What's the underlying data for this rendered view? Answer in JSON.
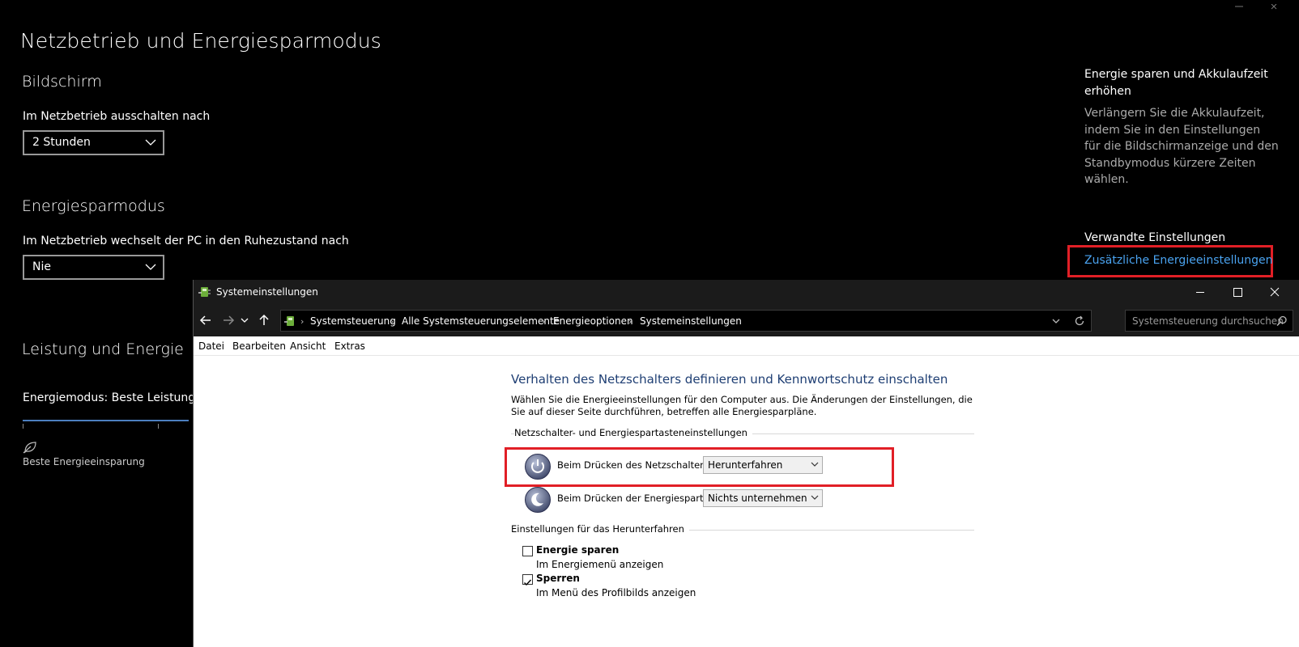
{
  "settings": {
    "page_title": "Netzbetrieb und Energiesparmodus",
    "display": {
      "title": "Bildschirm",
      "label": "Im Netzbetrieb ausschalten nach",
      "value": "2 Stunden"
    },
    "sleep": {
      "title": "Energiesparmodus",
      "label": "Im Netzbetrieb wechselt der PC in den Ruhezustand nach",
      "value": "Nie"
    },
    "performance": {
      "title": "Leistung und Energie",
      "mode_label": "Energiemodus: Beste Leistung",
      "slider_end_label": "Beste Energieeinsparung"
    },
    "side": {
      "tip_title": "Energie sparen und Akkulaufzeit erhöhen",
      "tip_text": "Verlängern Sie die Akkulaufzeit, indem Sie in den Einstellungen für die Bildschirmanzeige und den Standbymodus kürzere Zeiten wählen.",
      "related_title": "Verwandte Einstellungen",
      "related_link": "Zusätzliche Energieeinstellungen"
    }
  },
  "window": {
    "title": "Systemeinstellungen",
    "breadcrumbs": [
      "Systemsteuerung",
      "Alle Systemsteuerungselemente",
      "Energieoptionen",
      "Systemeinstellungen"
    ],
    "search_placeholder": "Systemsteuerung durchsuchen",
    "menu": [
      "Datei",
      "Bearbeiten",
      "Ansicht",
      "Extras"
    ],
    "heading": "Verhalten des Netzschalters definieren und Kennwortschutz einschalten",
    "description": "Wählen Sie die Energieeinstellungen für den Computer aus. Die Änderungen der Einstellungen, die Sie auf dieser Seite durchführen, betreffen alle Energiesparpläne.",
    "group_buttons": "Netzschalter- und Energiespartasteneinstellungen",
    "power_button": {
      "label": "Beim Drücken des Netzschalters:",
      "value": "Herunterfahren"
    },
    "sleep_button": {
      "label": "Beim Drücken der Energiespartaste:",
      "value": "Nichts unternehmen"
    },
    "group_shutdown": "Einstellungen für das Herunterfahren",
    "options": [
      {
        "label": "Energie sparen",
        "sub": "Im Energiemenü anzeigen",
        "checked": false
      },
      {
        "label": "Sperren",
        "sub": "Im Menü des Profilbilds anzeigen",
        "checked": true
      }
    ]
  },
  "colors": {
    "highlight_box": "#e11f26",
    "link": "#4aa3f0",
    "heading_blue": "#1e3e73"
  }
}
